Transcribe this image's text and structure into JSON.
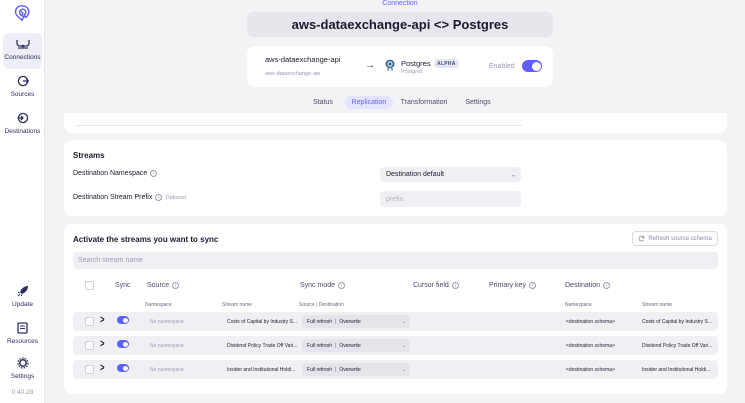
{
  "sidebar": {
    "logo": "airbyte-logo",
    "items": [
      {
        "label": "Connections",
        "icon": "connections-icon",
        "active": true
      },
      {
        "label": "Sources",
        "icon": "sources-icon",
        "active": false
      },
      {
        "label": "Destinations",
        "icon": "destinations-icon",
        "active": false
      }
    ],
    "bottom_items": [
      {
        "label": "Update",
        "icon": "rocket-icon"
      },
      {
        "label": "Resources",
        "icon": "book-icon"
      },
      {
        "label": "Settings",
        "icon": "gear-icon"
      }
    ],
    "version": "0.40.28"
  },
  "header": {
    "breadcrumb": "Connection",
    "title": "aws-dataexchange-api <> Postgres"
  },
  "connection": {
    "source_name": "aws-dataexchange-api",
    "source_sub": "aws-dataexchange-api",
    "destination_name": "Postgres",
    "destination_badge": "ALPHA",
    "destination_sub": "Postgres",
    "enabled_label": "Enabled",
    "enabled": true
  },
  "tabs": [
    {
      "label": "Status",
      "active": false
    },
    {
      "label": "Replication",
      "active": true
    },
    {
      "label": "Transformation",
      "active": false
    },
    {
      "label": "Settings",
      "active": false
    }
  ],
  "streams_section": {
    "title": "Streams",
    "namespace_label": "Destination Namespace",
    "namespace_value": "Destination default",
    "prefix_label": "Destination Stream Prefix",
    "prefix_optional": "Optional",
    "prefix_placeholder": "prefix"
  },
  "sync_section": {
    "title": "Activate the streams you want to sync",
    "refresh_label": "Refresh source schema",
    "search_placeholder": "Search stream name",
    "columns": {
      "sync": "Sync",
      "source": "Source",
      "sync_mode": "Sync mode",
      "cursor_field": "Cursor field",
      "primary_key": "Primary key",
      "destination": "Destination"
    },
    "sub_columns": {
      "namespace": "Namespace",
      "stream_name": "Stream name",
      "source_dest": "Source | Destination",
      "dest_namespace": "Namespace",
      "dest_stream_name": "Stream name"
    },
    "rows": [
      {
        "namespace": "No namespace",
        "stream_name": "Costs of Capital by Industry S...",
        "mode_source": "Full refresh",
        "mode_dest": "Overwrite",
        "dest_namespace": "<destination schema>",
        "dest_stream": "Costs of Capital by Industry S...",
        "enabled": true
      },
      {
        "namespace": "No namespace",
        "stream_name": "Dividend Policy Trade Off Vari...",
        "mode_source": "Full refresh",
        "mode_dest": "Overwrite",
        "dest_namespace": "<destination schema>",
        "dest_stream": "Dividend Policy Trade Off Vari...",
        "enabled": true
      },
      {
        "namespace": "No namespace",
        "stream_name": "Insider and Institutional Holdi...",
        "mode_source": "Full refresh",
        "mode_dest": "Overwrite",
        "dest_namespace": "<destination schema>",
        "dest_stream": "Insider and Institutional Holdi...",
        "enabled": true
      }
    ]
  },
  "colors": {
    "accent": "#615eff",
    "background": "#f3f3f6",
    "card": "#ffffff"
  }
}
